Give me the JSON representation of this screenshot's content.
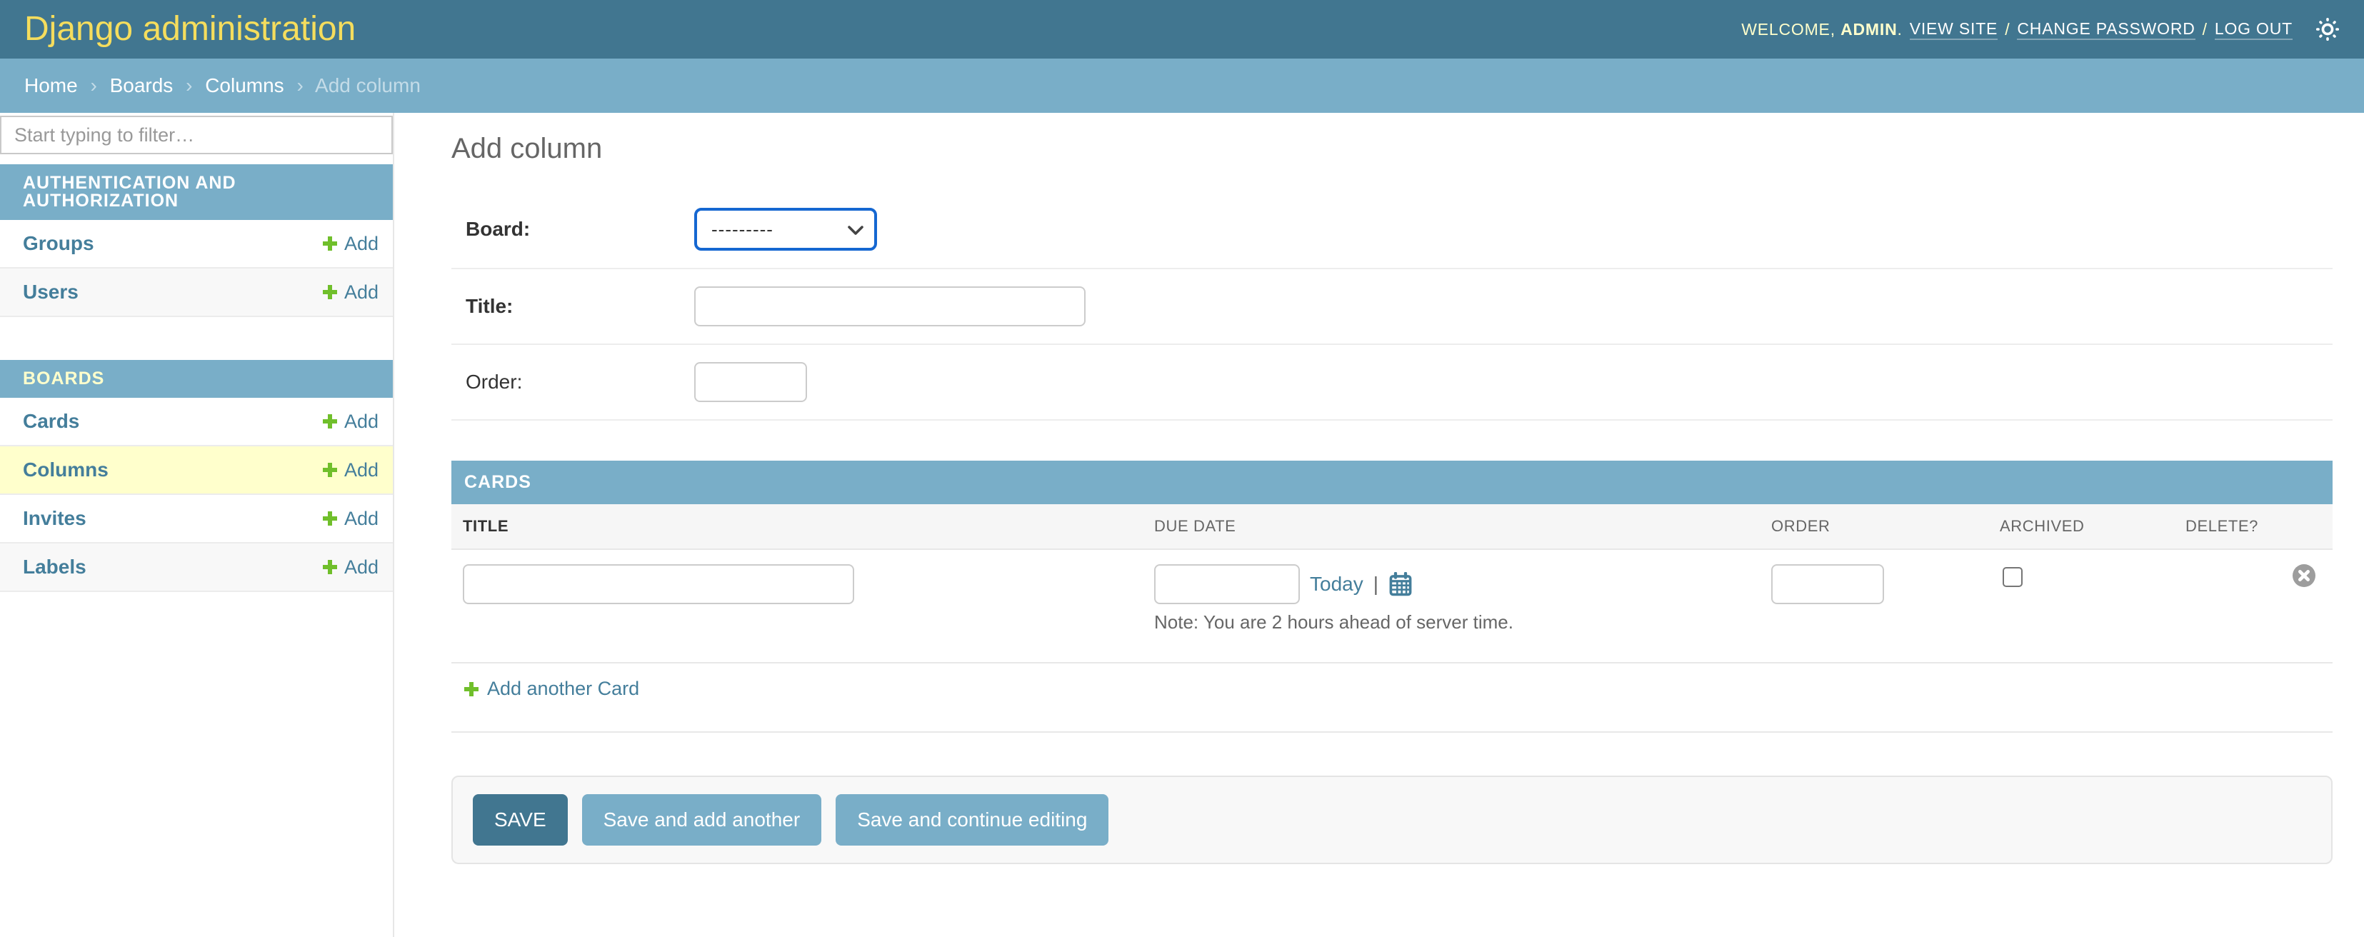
{
  "header": {
    "site_title": "Django administration",
    "welcome_prefix": "WELCOME,",
    "username": "ADMIN",
    "welcome_suffix": ".",
    "links": [
      "VIEW SITE",
      "CHANGE PASSWORD",
      "LOG OUT"
    ],
    "link_separator": "/"
  },
  "breadcrumbs": {
    "items": [
      "Home",
      "Boards",
      "Columns"
    ],
    "current": "Add column",
    "separator": "›"
  },
  "sidebar": {
    "filter_placeholder": "Start typing to filter…",
    "add_label": "Add",
    "sections": [
      {
        "title": "AUTHENTICATION AND AUTHORIZATION",
        "items": [
          {
            "label": "Groups"
          },
          {
            "label": "Users"
          }
        ]
      },
      {
        "title": "BOARDS",
        "items": [
          {
            "label": "Cards"
          },
          {
            "label": "Columns"
          },
          {
            "label": "Invites"
          },
          {
            "label": "Labels"
          }
        ]
      }
    ]
  },
  "main": {
    "page_title": "Add column",
    "form": {
      "board": {
        "label": "Board:",
        "value": "---------"
      },
      "title": {
        "label": "Title:",
        "value": ""
      },
      "order": {
        "label": "Order:",
        "value": ""
      }
    },
    "inline": {
      "title": "CARDS",
      "columns": [
        "TITLE",
        "DUE DATE",
        "ORDER",
        "ARCHIVED",
        "DELETE?"
      ],
      "row": {
        "title_value": "",
        "due_date_value": "",
        "order_value": ""
      },
      "today_label": "Today",
      "date_separator": "|",
      "server_time_note": "Note: You are 2 hours ahead of server time.",
      "add_another_label": "Add another Card"
    },
    "submit": {
      "save": "SAVE",
      "save_add_another": "Save and add another",
      "save_continue": "Save and continue editing"
    }
  },
  "colors": {
    "header_bg": "#417690",
    "accent_yellow": "#f5dd5d",
    "header_fg": "#ffffcc",
    "breadcrumbs_bg": "#79aec8",
    "breadcrumbs_fg": "#c4dce8",
    "module_caption_bg": "#79aec8",
    "link": "#447e9b",
    "add_green": "#70bf2b",
    "selected_row": "#ffffcc",
    "alt_row": "#f8f8f8",
    "hairline": "#e8e8e8",
    "button_light_bg": "#79aec8",
    "button_default_bg": "#417690",
    "select_focus_blue": "#1567d1",
    "delete_icon_gray": "#9d9d9d"
  }
}
